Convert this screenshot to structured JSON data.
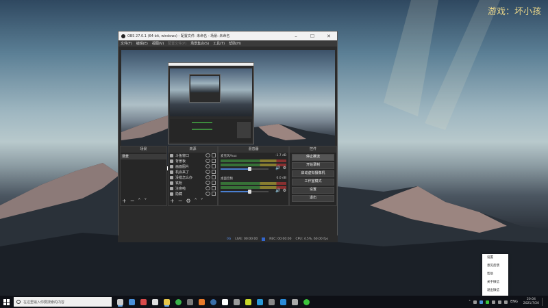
{
  "watermark": "游戏：坏小孩",
  "obs": {
    "title": "OBS 27.0.1 (64-bit, windows) - 配置文件: 未命名 - 场景: 未命名",
    "menu": [
      "文件(F)",
      "编辑(E)",
      "视图(V)",
      "配置文件(P)",
      "场景集合(S)",
      "工具(T)",
      "帮助(H)"
    ],
    "dim_menu_index": 3,
    "preview_search_placeholder": "在这里输入你要搜索的内容",
    "scenes": {
      "header": "场景",
      "items": [
        "场景"
      ]
    },
    "sources": {
      "header": "来源",
      "items": [
        "斗鱼窗口",
        "背景板",
        "画面图片",
        "机会来了",
        "没错怎么办",
        "铁粉",
        "注意啦",
        "隐藏"
      ]
    },
    "mixer": {
      "header": "混音器",
      "tracks": [
        {
          "name": "麦克风/Aux",
          "db": "-1.7 dB",
          "level": 0.6
        },
        {
          "name": "桌面音频",
          "db": "0.0 dB",
          "level": 0.6
        }
      ]
    },
    "controls": {
      "header": "控件",
      "buttons": [
        "停止推流",
        "开始录制",
        "启动虚拟摄像机",
        "工作室模式",
        "设置",
        "退出"
      ],
      "active_index": 0
    },
    "status": {
      "dropped": "0G",
      "live": "LIVE: 00:00:00",
      "rec": "REC: 00:00:00",
      "cpu": "CPU: 4.5%, 60.00 fps"
    }
  },
  "tray_menu": [
    "设置",
    "意见反馈",
    "帮助",
    "关于微信",
    "退出微信"
  ],
  "taskbar": {
    "search_placeholder": "在这里输入你要搜索的内容",
    "icons": [
      {
        "name": "obs-icon",
        "color": "#cccccc"
      },
      {
        "name": "app2-icon",
        "color": "#4a90d9"
      },
      {
        "name": "app3-icon",
        "color": "#d94a4a"
      },
      {
        "name": "app4-icon",
        "color": "#e0e0e0"
      },
      {
        "name": "folder-icon",
        "color": "#e8c84a"
      },
      {
        "name": "chrome-icon",
        "color": "#3bb34a"
      },
      {
        "name": "app7-icon",
        "color": "#7a7a7a"
      },
      {
        "name": "app8-icon",
        "color": "#e87a2a"
      },
      {
        "name": "steam-icon",
        "color": "#3a6ea8"
      },
      {
        "name": "app10-icon",
        "color": "#ffffff"
      },
      {
        "name": "app11-icon",
        "color": "#9a9a9a"
      },
      {
        "name": "app12-icon",
        "color": "#c8d82a"
      },
      {
        "name": "app13-icon",
        "color": "#2a9ad8"
      },
      {
        "name": "app14-icon",
        "color": "#888888"
      },
      {
        "name": "app15-icon",
        "color": "#2a8ad8"
      },
      {
        "name": "app16-icon",
        "color": "#aaaaaa"
      },
      {
        "name": "wechat-icon",
        "color": "#3bc43b"
      }
    ],
    "language": "ENG",
    "time": "20:04",
    "date": "2021/7/20"
  }
}
